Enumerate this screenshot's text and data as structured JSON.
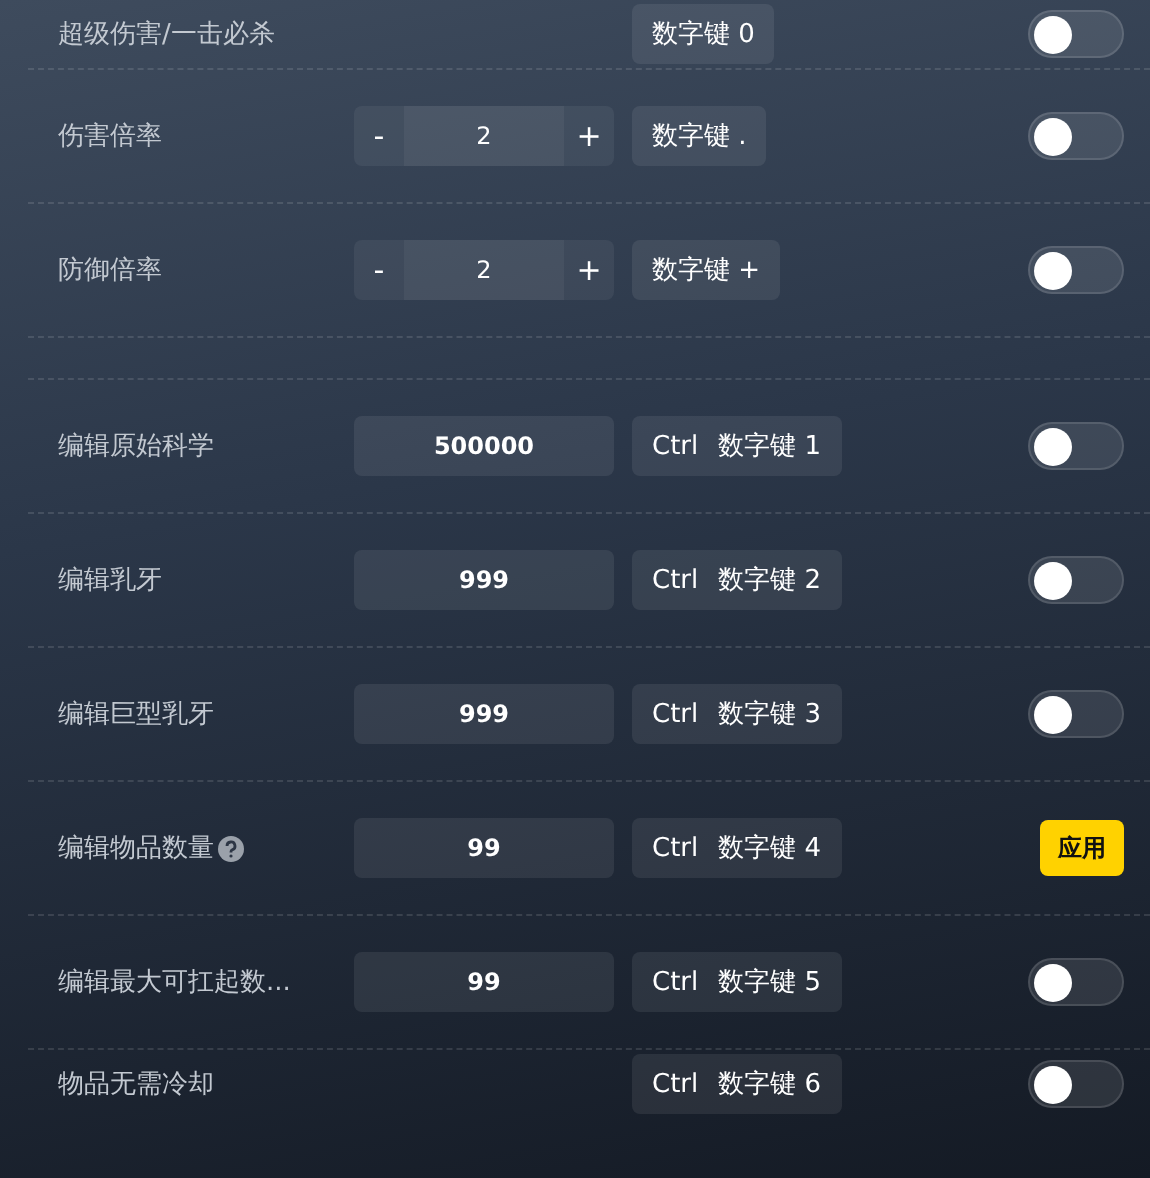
{
  "groups": [
    {
      "rows": [
        {
          "label": "超级伤害/一击必杀",
          "help": false,
          "kind": "plain",
          "hotkey": [
            "数字键 0"
          ],
          "action": {
            "kind": "toggle",
            "on": false
          }
        },
        {
          "label": "伤害倍率",
          "help": false,
          "kind": "stepper",
          "minus": "-",
          "value": "2",
          "plus": "+",
          "hotkey": [
            "数字键 ."
          ],
          "action": {
            "kind": "toggle",
            "on": false
          }
        },
        {
          "label": "防御倍率",
          "help": false,
          "kind": "stepper",
          "minus": "-",
          "value": "2",
          "plus": "+",
          "hotkey": [
            "数字键 +"
          ],
          "action": {
            "kind": "toggle",
            "on": false
          }
        }
      ]
    },
    {
      "rows": [
        {
          "label": "编辑原始科学",
          "help": false,
          "kind": "number",
          "value": "500000",
          "hotkey": [
            "Ctrl",
            "数字键 1"
          ],
          "action": {
            "kind": "toggle",
            "on": false
          }
        },
        {
          "label": "编辑乳牙",
          "help": false,
          "kind": "number",
          "value": "999",
          "hotkey": [
            "Ctrl",
            "数字键 2"
          ],
          "action": {
            "kind": "toggle",
            "on": false
          }
        },
        {
          "label": "编辑巨型乳牙",
          "help": false,
          "kind": "number",
          "value": "999",
          "hotkey": [
            "Ctrl",
            "数字键 3"
          ],
          "action": {
            "kind": "toggle",
            "on": false
          }
        },
        {
          "label": "编辑物品数量",
          "help": true,
          "kind": "number",
          "value": "99",
          "hotkey": [
            "Ctrl",
            "数字键 4"
          ],
          "action": {
            "kind": "button",
            "label": "应用"
          }
        },
        {
          "label": "编辑最大可扛起数...",
          "help": false,
          "kind": "number",
          "value": "99",
          "hotkey": [
            "Ctrl",
            "数字键 5"
          ],
          "action": {
            "kind": "toggle",
            "on": false
          }
        },
        {
          "label": "物品无需冷却",
          "help": false,
          "kind": "plain",
          "hotkey": [
            "Ctrl",
            "数字键 6"
          ],
          "action": {
            "kind": "toggle",
            "on": false
          }
        }
      ]
    }
  ]
}
